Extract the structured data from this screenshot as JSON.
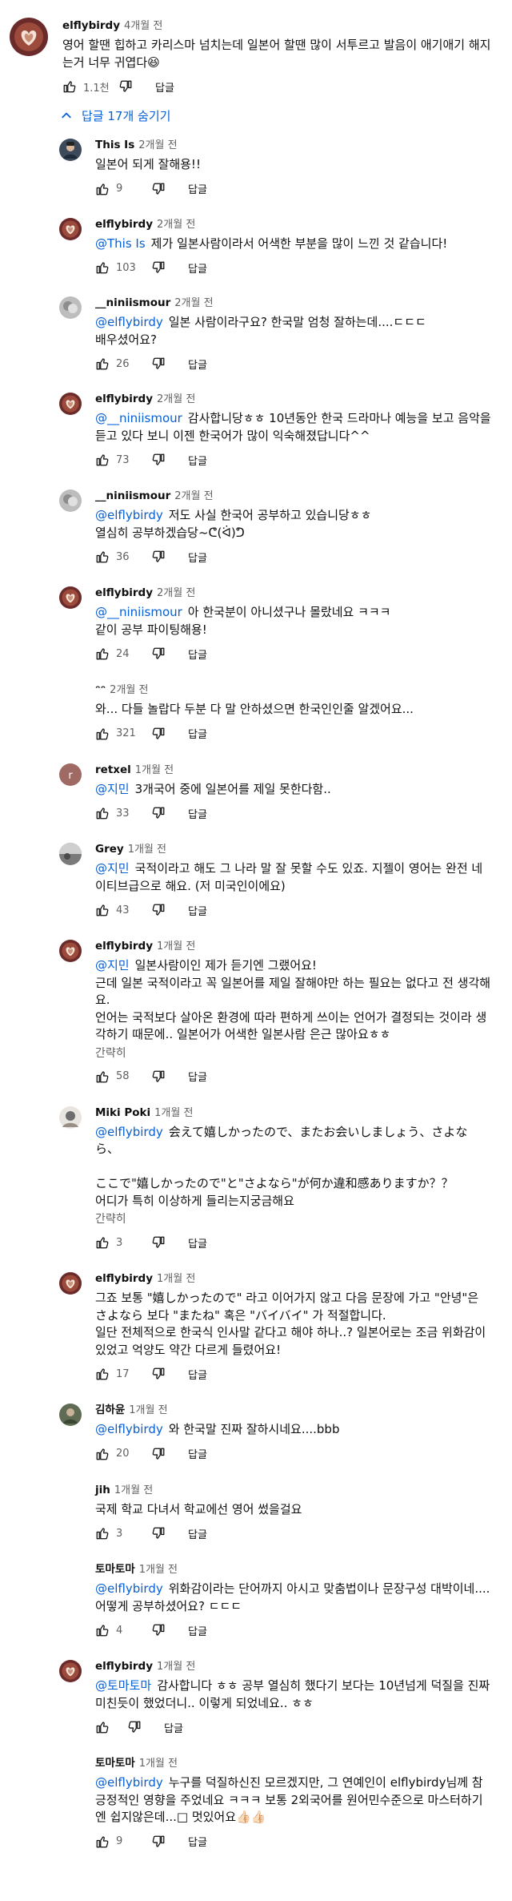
{
  "labels": {
    "reply": "답글",
    "collapse": "간략히"
  },
  "top_comment": {
    "author": "elflybirdy",
    "time": "4개월 전",
    "text": "영어 할땐 힙하고 카리스마 넘치는데 일본어 할땐 많이 서투르고 발음이 애기애기 해지는거 너무 귀엽다😆",
    "likes": "1.1천"
  },
  "toggle": {
    "label": "답글 17개 숨기기",
    "icon": "chevron-up-icon"
  },
  "replies": [
    {
      "author": "This Is",
      "time": "2개월 전",
      "mention": "",
      "text": "일본어 되게 잘해용!!",
      "likes": "9",
      "avatar": "photo",
      "more": ""
    },
    {
      "author": "elflybirdy",
      "time": "2개월 전",
      "mention": "@This Is",
      "text": "제가 일본사람이라서 어색한 부분을 많이 느낀 것 같습니다!",
      "likes": "103",
      "avatar": "latte",
      "more": ""
    },
    {
      "author": "__niniismour",
      "time": "2개월 전",
      "mention": "@elflybirdy",
      "text": "일본 사람이라구요? 한국말 엄청 잘하는데....ㄷㄷㄷ\n배우셨어요?",
      "likes": "26",
      "avatar": "gray",
      "more": ""
    },
    {
      "author": "elflybirdy",
      "time": "2개월 전",
      "mention": "@__niniismour",
      "text": "감사합니당ㅎㅎ 10년동안 한국 드라마나 예능을 보고 음악을 듣고 있다 보니 이젠 한국어가 많이 익숙해졌답니다^^",
      "likes": "73",
      "avatar": "latte",
      "more": ""
    },
    {
      "author": "__niniismour",
      "time": "2개월 전",
      "mention": "@elflybirdy",
      "text": "저도 사실 한국어 공부하고 있습니당ㅎㅎ\n열심히 공부하겠습당~ᕦ(ᐛ)ᕤ",
      "likes": "36",
      "avatar": "gray",
      "more": ""
    },
    {
      "author": "elflybirdy",
      "time": "2개월 전",
      "mention": "@__niniismour",
      "text": "아 한국분이 아니셨구나 몰랐네요 ㅋㅋㅋ\n같이 공부 파이팅해용!",
      "likes": "24",
      "avatar": "latte",
      "more": ""
    },
    {
      "author": "ᵔᵔ",
      "time": "2개월 전",
      "mention": "",
      "text": "와... 다들 놀랍다 두분 다 말 안하셨으면 한국인인줄 알겠어요...",
      "likes": "321",
      "avatar": "blank",
      "more": ""
    },
    {
      "author": "retxel",
      "time": "1개월 전",
      "mention": "@지민",
      "text": "3개국어 중에 일본어를 제일 못한다함..",
      "likes": "33",
      "avatar": "r",
      "more": ""
    },
    {
      "author": "Grey",
      "time": "1개월 전",
      "mention": "@지민",
      "text": "국적이라고 해도 그 나라 말 잘 못할 수도 있죠. 지젤이 영어는 완전 네이티브급으로 해요. (저 미국인이에요)",
      "likes": "43",
      "avatar": "grey",
      "more": ""
    },
    {
      "author": "elflybirdy",
      "time": "1개월 전",
      "mention": "@지민",
      "text": "일본사람이인 제가 듣기엔 그랬어요!\n근데 일본 국적이라고 꼭 일본어를 제일 잘해야만 하는 필요는 없다고 전 생각해요.\n언어는 국적보다 살아온 환경에 따라 편하게 쓰이는 언어가 결정되는 것이라 생각하기 때문에.. 일본어가 어색한 일본사람 은근 많아요ㅎㅎ",
      "likes": "58",
      "avatar": "latte",
      "more": "간략히"
    },
    {
      "author": "Miki Poki",
      "time": "1개월 전",
      "mention": "@elflybirdy",
      "text": "会えて嬉しかったので、またお会いしましょう、さよなら、\n\nここで\"嬉しかったので\"と\"さよなら\"が何か違和感ありますか？？\n어디가 특히 이상하게 들리는지궁금해요",
      "likes": "3",
      "avatar": "miki",
      "more": "간략히"
    },
    {
      "author": "elflybirdy",
      "time": "1개월 전",
      "mention": "",
      "text": "그죠 보통 \"嬉しかったので\" 라고 이어가지 않고 다음 문장에 가고 \"안녕\"은 さよなら 보다 \"またね\" 혹은 \"バイバイ\" 가 적절합니다.\n일단 전체적으로 한국식 인사말 같다고 해야 하나..? 일본어로는 조금 위화감이 있었고 억양도 약간 다르게 들렸어요!",
      "likes": "17",
      "avatar": "latte",
      "more": ""
    },
    {
      "author": "김하윤",
      "time": "1개월 전",
      "mention": "@elflybirdy",
      "text": "와 한국말 진짜 잘하시네요....bbb",
      "likes": "20",
      "avatar": "kim",
      "more": ""
    },
    {
      "author": "jih",
      "time": "1개월 전",
      "mention": "",
      "text": "국제 학교 다녀서 학교에선 영어 썼을걸요",
      "likes": "3",
      "avatar": "blank",
      "more": ""
    },
    {
      "author": "토마토마",
      "time": "1개월 전",
      "mention": "@elflybirdy",
      "text": "위화감이라는 단어까지 아시고 맞춤법이나 문장구성 대박이네....어떻게 공부하셨어요? ㄷㄷㄷ",
      "likes": "4",
      "avatar": "blank",
      "more": ""
    },
    {
      "author": "elflybirdy",
      "time": "1개월 전",
      "mention": "@토마토마",
      "text": "감사합니다 ㅎㅎ 공부 열심히 했다기 보다는 10년넘게 덕질을 진짜 미친듯이 했었더니.. 이렇게 되었네요.. ㅎㅎ",
      "likes": "",
      "avatar": "latte",
      "more": ""
    },
    {
      "author": "토마토마",
      "time": "1개월 전",
      "mention": "@elflybirdy",
      "text": "누구를 덕질하신진 모르겠지만, 그 연예인이 elflybirdy님께 참 긍정적인 영향을 주었네요 ㅋㅋㅋ 보통 2외국어를 원어민수준으로 마스터하기엔 쉽지않은데...□ 멋있어요👍🏻👍🏻",
      "likes": "9",
      "avatar": "blank",
      "more": ""
    }
  ]
}
